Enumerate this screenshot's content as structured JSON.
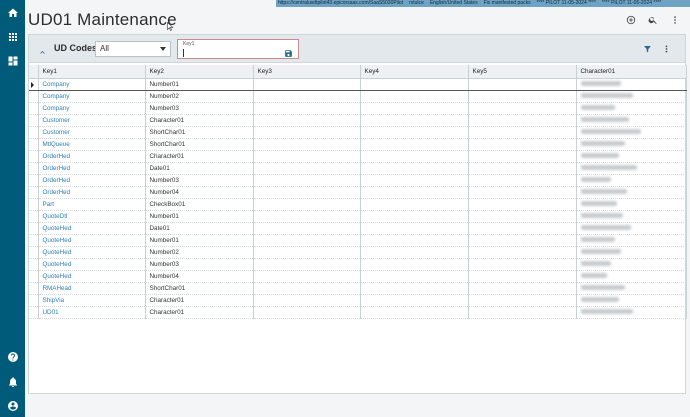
{
  "status_strip": {
    "url": "https://centralusdtpilot43.epicorsaas.com/SaaS5030Pilot",
    "user": "rstulce",
    "locale": "English/United States",
    "pack": "Fix manifested packs",
    "env1": "**** PILOT 11-05-2024 ****",
    "env2": "**** PILOT 11-05-2024 ****"
  },
  "page": {
    "title": "UD01 Maintenance"
  },
  "toolbar": {
    "title": "UD Codes",
    "filter_value": "All",
    "key_field_label": "Key1",
    "key_field_value": ""
  },
  "grid": {
    "columns": [
      "Key1",
      "Key2",
      "Key3",
      "Key4",
      "Key5",
      "Character01"
    ],
    "rows": [
      {
        "key1": "Company",
        "key2": "Number01",
        "blur": 40
      },
      {
        "key1": "Company",
        "key2": "Number02",
        "blur": 52
      },
      {
        "key1": "Company",
        "key2": "Number03",
        "blur": 34
      },
      {
        "key1": "Customer",
        "key2": "Character01",
        "blur": 48
      },
      {
        "key1": "Customer",
        "key2": "ShortChar01",
        "blur": 60
      },
      {
        "key1": "MtlQueue",
        "key2": "ShortChar01",
        "blur": 44
      },
      {
        "key1": "OrderHed",
        "key2": "Character01",
        "blur": 38
      },
      {
        "key1": "OrderHed",
        "key2": "Date01",
        "blur": 56
      },
      {
        "key1": "OrderHed",
        "key2": "Number03",
        "blur": 30
      },
      {
        "key1": "OrderHed",
        "key2": "Number04",
        "blur": 46
      },
      {
        "key1": "Part",
        "key2": "CheckBox01",
        "blur": 36
      },
      {
        "key1": "QuoteDtl",
        "key2": "Number01",
        "blur": 42
      },
      {
        "key1": "QuoteHed",
        "key2": "Date01",
        "blur": 50
      },
      {
        "key1": "QuoteHed",
        "key2": "Number01",
        "blur": 34
      },
      {
        "key1": "QuoteHed",
        "key2": "Number02",
        "blur": 40
      },
      {
        "key1": "QuoteHed",
        "key2": "Number03",
        "blur": 30
      },
      {
        "key1": "QuoteHed",
        "key2": "Number04",
        "blur": 26
      },
      {
        "key1": "RMAHead",
        "key2": "ShortChar01",
        "blur": 44
      },
      {
        "key1": "ShipVia",
        "key2": "Character01",
        "blur": 38
      },
      {
        "key1": "UD01",
        "key2": "Character01",
        "blur": 52
      }
    ]
  },
  "icons": {
    "rail": [
      "home-icon",
      "apps-grid-icon",
      "dashboard-icon",
      "help-icon",
      "notifications-icon",
      "user-account-icon"
    ],
    "header": [
      "add-new-icon",
      "search-icon",
      "more-vert-icon"
    ],
    "toolbar": [
      "collapse-icon",
      "filter-icon",
      "more-vert-icon"
    ]
  },
  "colors": {
    "rail": "#005a7a",
    "link": "#2f7fb1",
    "strip": "#6fa3c4"
  }
}
